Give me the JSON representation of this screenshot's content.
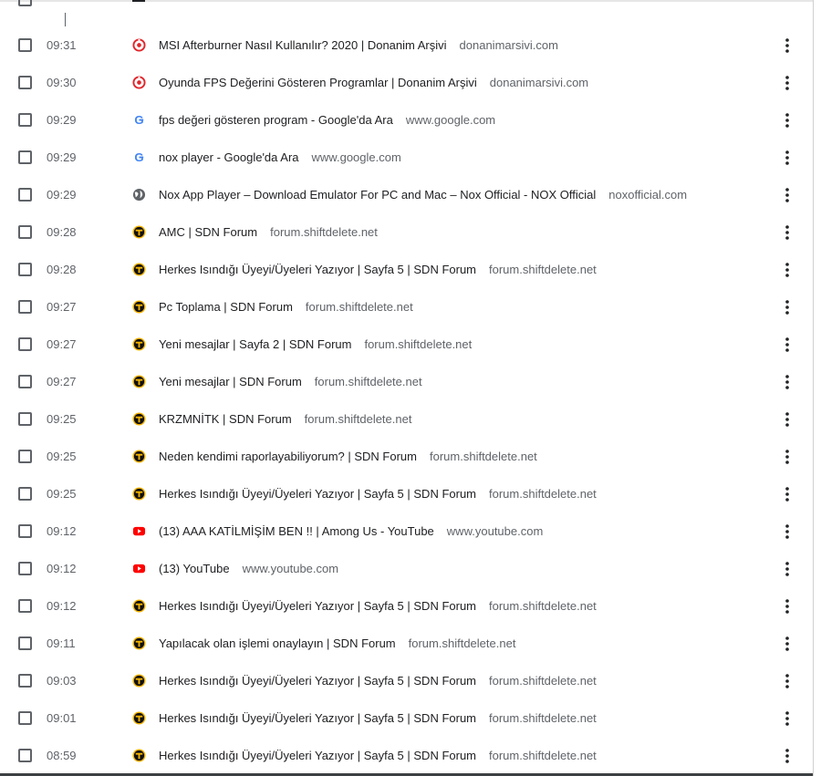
{
  "history": {
    "entries": [
      {
        "time": "09:31",
        "title": "MSI Afterburner Nasıl Kullanılır? 2020 | Donanim Arşivi",
        "domain": "donanimarsivi.com",
        "icon": "donanimarsivi"
      },
      {
        "time": "09:30",
        "title": "Oyunda FPS Değerini Gösteren Programlar | Donanim Arşivi",
        "domain": "donanimarsivi.com",
        "icon": "donanimarsivi"
      },
      {
        "time": "09:29",
        "title": "fps değeri gösteren program - Google'da Ara",
        "domain": "www.google.com",
        "icon": "google"
      },
      {
        "time": "09:29",
        "title": "nox player - Google'da Ara",
        "domain": "www.google.com",
        "icon": "google"
      },
      {
        "time": "09:29",
        "title": "Nox App Player – Download Emulator For PC and Mac – Nox Official - NOX Official",
        "domain": "noxofficial.com",
        "icon": "globe"
      },
      {
        "time": "09:28",
        "title": "AMC | SDN Forum",
        "domain": "forum.shiftdelete.net",
        "icon": "sdn"
      },
      {
        "time": "09:28",
        "title": "Herkes Isındığı Üyeyi/Üyeleri Yazıyor | Sayfa 5 | SDN Forum",
        "domain": "forum.shiftdelete.net",
        "icon": "sdn"
      },
      {
        "time": "09:27",
        "title": "Pc Toplama | SDN Forum",
        "domain": "forum.shiftdelete.net",
        "icon": "sdn"
      },
      {
        "time": "09:27",
        "title": "Yeni mesajlar | Sayfa 2 | SDN Forum",
        "domain": "forum.shiftdelete.net",
        "icon": "sdn"
      },
      {
        "time": "09:27",
        "title": "Yeni mesajlar | SDN Forum",
        "domain": "forum.shiftdelete.net",
        "icon": "sdn"
      },
      {
        "time": "09:25",
        "title": "KRZMNİTK | SDN Forum",
        "domain": "forum.shiftdelete.net",
        "icon": "sdn"
      },
      {
        "time": "09:25",
        "title": "Neden kendimi raporlayabiliyorum? | SDN Forum",
        "domain": "forum.shiftdelete.net",
        "icon": "sdn"
      },
      {
        "time": "09:25",
        "title": "Herkes Isındığı Üyeyi/Üyeleri Yazıyor | Sayfa 5 | SDN Forum",
        "domain": "forum.shiftdelete.net",
        "icon": "sdn"
      },
      {
        "time": "09:12",
        "title": "(13) AAA KATİLMİŞİM BEN !! | Among Us - YouTube",
        "domain": "www.youtube.com",
        "icon": "youtube"
      },
      {
        "time": "09:12",
        "title": "(13) YouTube",
        "domain": "www.youtube.com",
        "icon": "youtube"
      },
      {
        "time": "09:12",
        "title": "Herkes Isındığı Üyeyi/Üyeleri Yazıyor | Sayfa 5 | SDN Forum",
        "domain": "forum.shiftdelete.net",
        "icon": "sdn"
      },
      {
        "time": "09:11",
        "title": "Yapılacak olan işlemi onaylayın | SDN Forum",
        "domain": "forum.shiftdelete.net",
        "icon": "sdn"
      },
      {
        "time": "09:03",
        "title": "Herkes Isındığı Üyeyi/Üyeleri Yazıyor | Sayfa 5 | SDN Forum",
        "domain": "forum.shiftdelete.net",
        "icon": "sdn"
      },
      {
        "time": "09:01",
        "title": "Herkes Isındığı Üyeyi/Üyeleri Yazıyor | Sayfa 5 | SDN Forum",
        "domain": "forum.shiftdelete.net",
        "icon": "sdn"
      },
      {
        "time": "08:59",
        "title": "Herkes Isındığı Üyeyi/Üyeleri Yazıyor | Sayfa 5 | SDN Forum",
        "domain": "forum.shiftdelete.net",
        "icon": "sdn"
      }
    ]
  },
  "colors": {
    "text": "#202124",
    "secondary": "#5f6368",
    "youtube": "#ff0000",
    "sdn_bg": "#f4b400",
    "donanim": "#e0262b"
  }
}
